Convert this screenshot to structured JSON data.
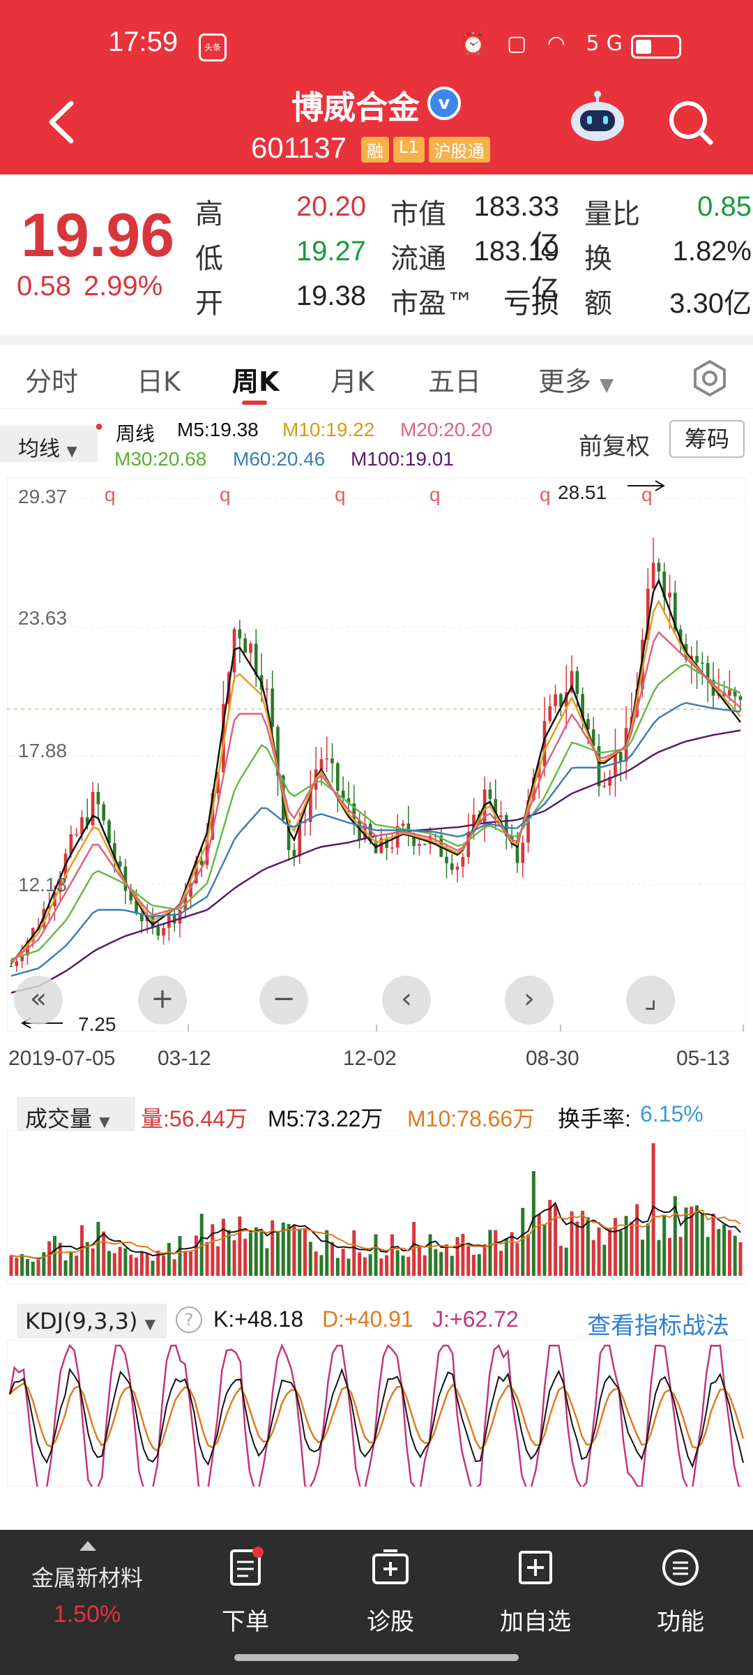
{
  "status": {
    "time": "17:59",
    "news": "头条",
    "net": "5G"
  },
  "header": {
    "title": "博威合金",
    "code": "601137",
    "tags": [
      "融",
      "L1",
      "沪股通"
    ]
  },
  "quote": {
    "price": "19.96",
    "change": "0.58",
    "change_pct": "2.99%",
    "labels": {
      "high": "高",
      "low": "低",
      "open": "开",
      "mkt_cap": "市值",
      "float": "流通",
      "pe": "市盈™",
      "vol_ratio": "量比",
      "turnover": "换",
      "amount": "额"
    },
    "values": {
      "high": "20.20",
      "low": "19.27",
      "open": "19.38",
      "mkt_cap": "183.33亿",
      "float": "183.19亿",
      "pe": "亏损",
      "vol_ratio": "0.85",
      "turnover": "1.82%",
      "amount": "3.30亿"
    }
  },
  "tabs": [
    "分时",
    "日K",
    "周K",
    "月K",
    "五日",
    "更多"
  ],
  "active_tab": "周K",
  "ma": {
    "select": "均线",
    "period": "周线",
    "m5": "M5:19.38",
    "m10": "M10:19.22",
    "m20": "M20:20.20",
    "m30": "M30:20.68",
    "m60": "M60:20.46",
    "m100": "M100:19.01",
    "fq": "前复权",
    "chips": "筹码"
  },
  "colors": {
    "red": "#d8363b",
    "green": "#1a9a3a",
    "m5": "#111111",
    "m10": "#e0a020",
    "m20": "#e06080",
    "m30": "#66bb44",
    "m60": "#3a7fb5",
    "m100": "#5a1a6a",
    "up_candle": "#d8363b",
    "down_candle": "#2a7a2a"
  },
  "kline": {
    "y_ticks": [
      "29.37",
      "23.63",
      "17.88",
      "12.13"
    ],
    "high_label": "28.51",
    "low_label": "7.25",
    "q_marker": "q",
    "x_ticks": [
      "2019-07-05",
      "03-12",
      "12-02",
      "08-30",
      "05-13"
    ]
  },
  "volume": {
    "select": "成交量",
    "vol": "量:56.44万",
    "m5": "M5:73.22万",
    "m10": "M10:78.66万",
    "turnover_label": "换手率:",
    "turnover": "6.15%"
  },
  "kdj": {
    "select": "KDJ(9,3,3)",
    "help": "?",
    "k": "K:+48.18",
    "d": "D:+40.91",
    "j": "J:+62.72",
    "strategy": "查看指标战法"
  },
  "bottom_nav": {
    "metal_title": "金属新材料",
    "metal_pct": "1.50%",
    "items": [
      "下单",
      "诊股",
      "加自选",
      "功能"
    ]
  },
  "chart_data": {
    "type": "candlestick",
    "title": "",
    "xlabel": "",
    "ylabel": "",
    "x": [
      "2019-07-05",
      "03-12",
      "12-02",
      "08-30",
      "05-13"
    ],
    "ylim": [
      7.25,
      29.37
    ],
    "approx_close": [
      8.5,
      10.5,
      13.5,
      16.0,
      12.0,
      10.0,
      11.0,
      14.0,
      24.0,
      21.5,
      13.0,
      18.0,
      15.5,
      13.5,
      14.5,
      14.0,
      13.0,
      16.5,
      13.0,
      19.0,
      21.5,
      17.0,
      18.5,
      27.0,
      23.0,
      21.0,
      19.96
    ],
    "series": [
      {
        "name": "M5",
        "values": [
          8.6,
          10.2,
          13.2,
          15.4,
          12.4,
          10.3,
          11.2,
          14.5,
          23.0,
          21.0,
          13.8,
          17.4,
          15.2,
          13.8,
          14.4,
          14.0,
          13.4,
          16.0,
          13.6,
          18.6,
          21.0,
          17.4,
          18.4,
          26.0,
          22.6,
          21.0,
          19.38
        ]
      },
      {
        "name": "M30",
        "values": [
          8.8,
          9.2,
          10.6,
          12.8,
          12.2,
          11.2,
          11.0,
          12.2,
          16.5,
          18.5,
          16.0,
          16.8,
          15.8,
          14.8,
          14.6,
          14.4,
          13.8,
          14.8,
          14.2,
          16.0,
          18.5,
          18.0,
          18.2,
          21.0,
          22.0,
          21.2,
          20.68
        ]
      },
      {
        "name": "M100",
        "values": [
          7.3,
          7.6,
          8.3,
          9.2,
          9.8,
          10.2,
          10.6,
          11.0,
          12.0,
          12.8,
          13.3,
          13.8,
          14.0,
          14.3,
          14.5,
          14.6,
          14.7,
          14.9,
          15.0,
          15.4,
          16.2,
          16.7,
          17.2,
          18.0,
          18.5,
          18.8,
          19.01
        ]
      }
    ]
  }
}
